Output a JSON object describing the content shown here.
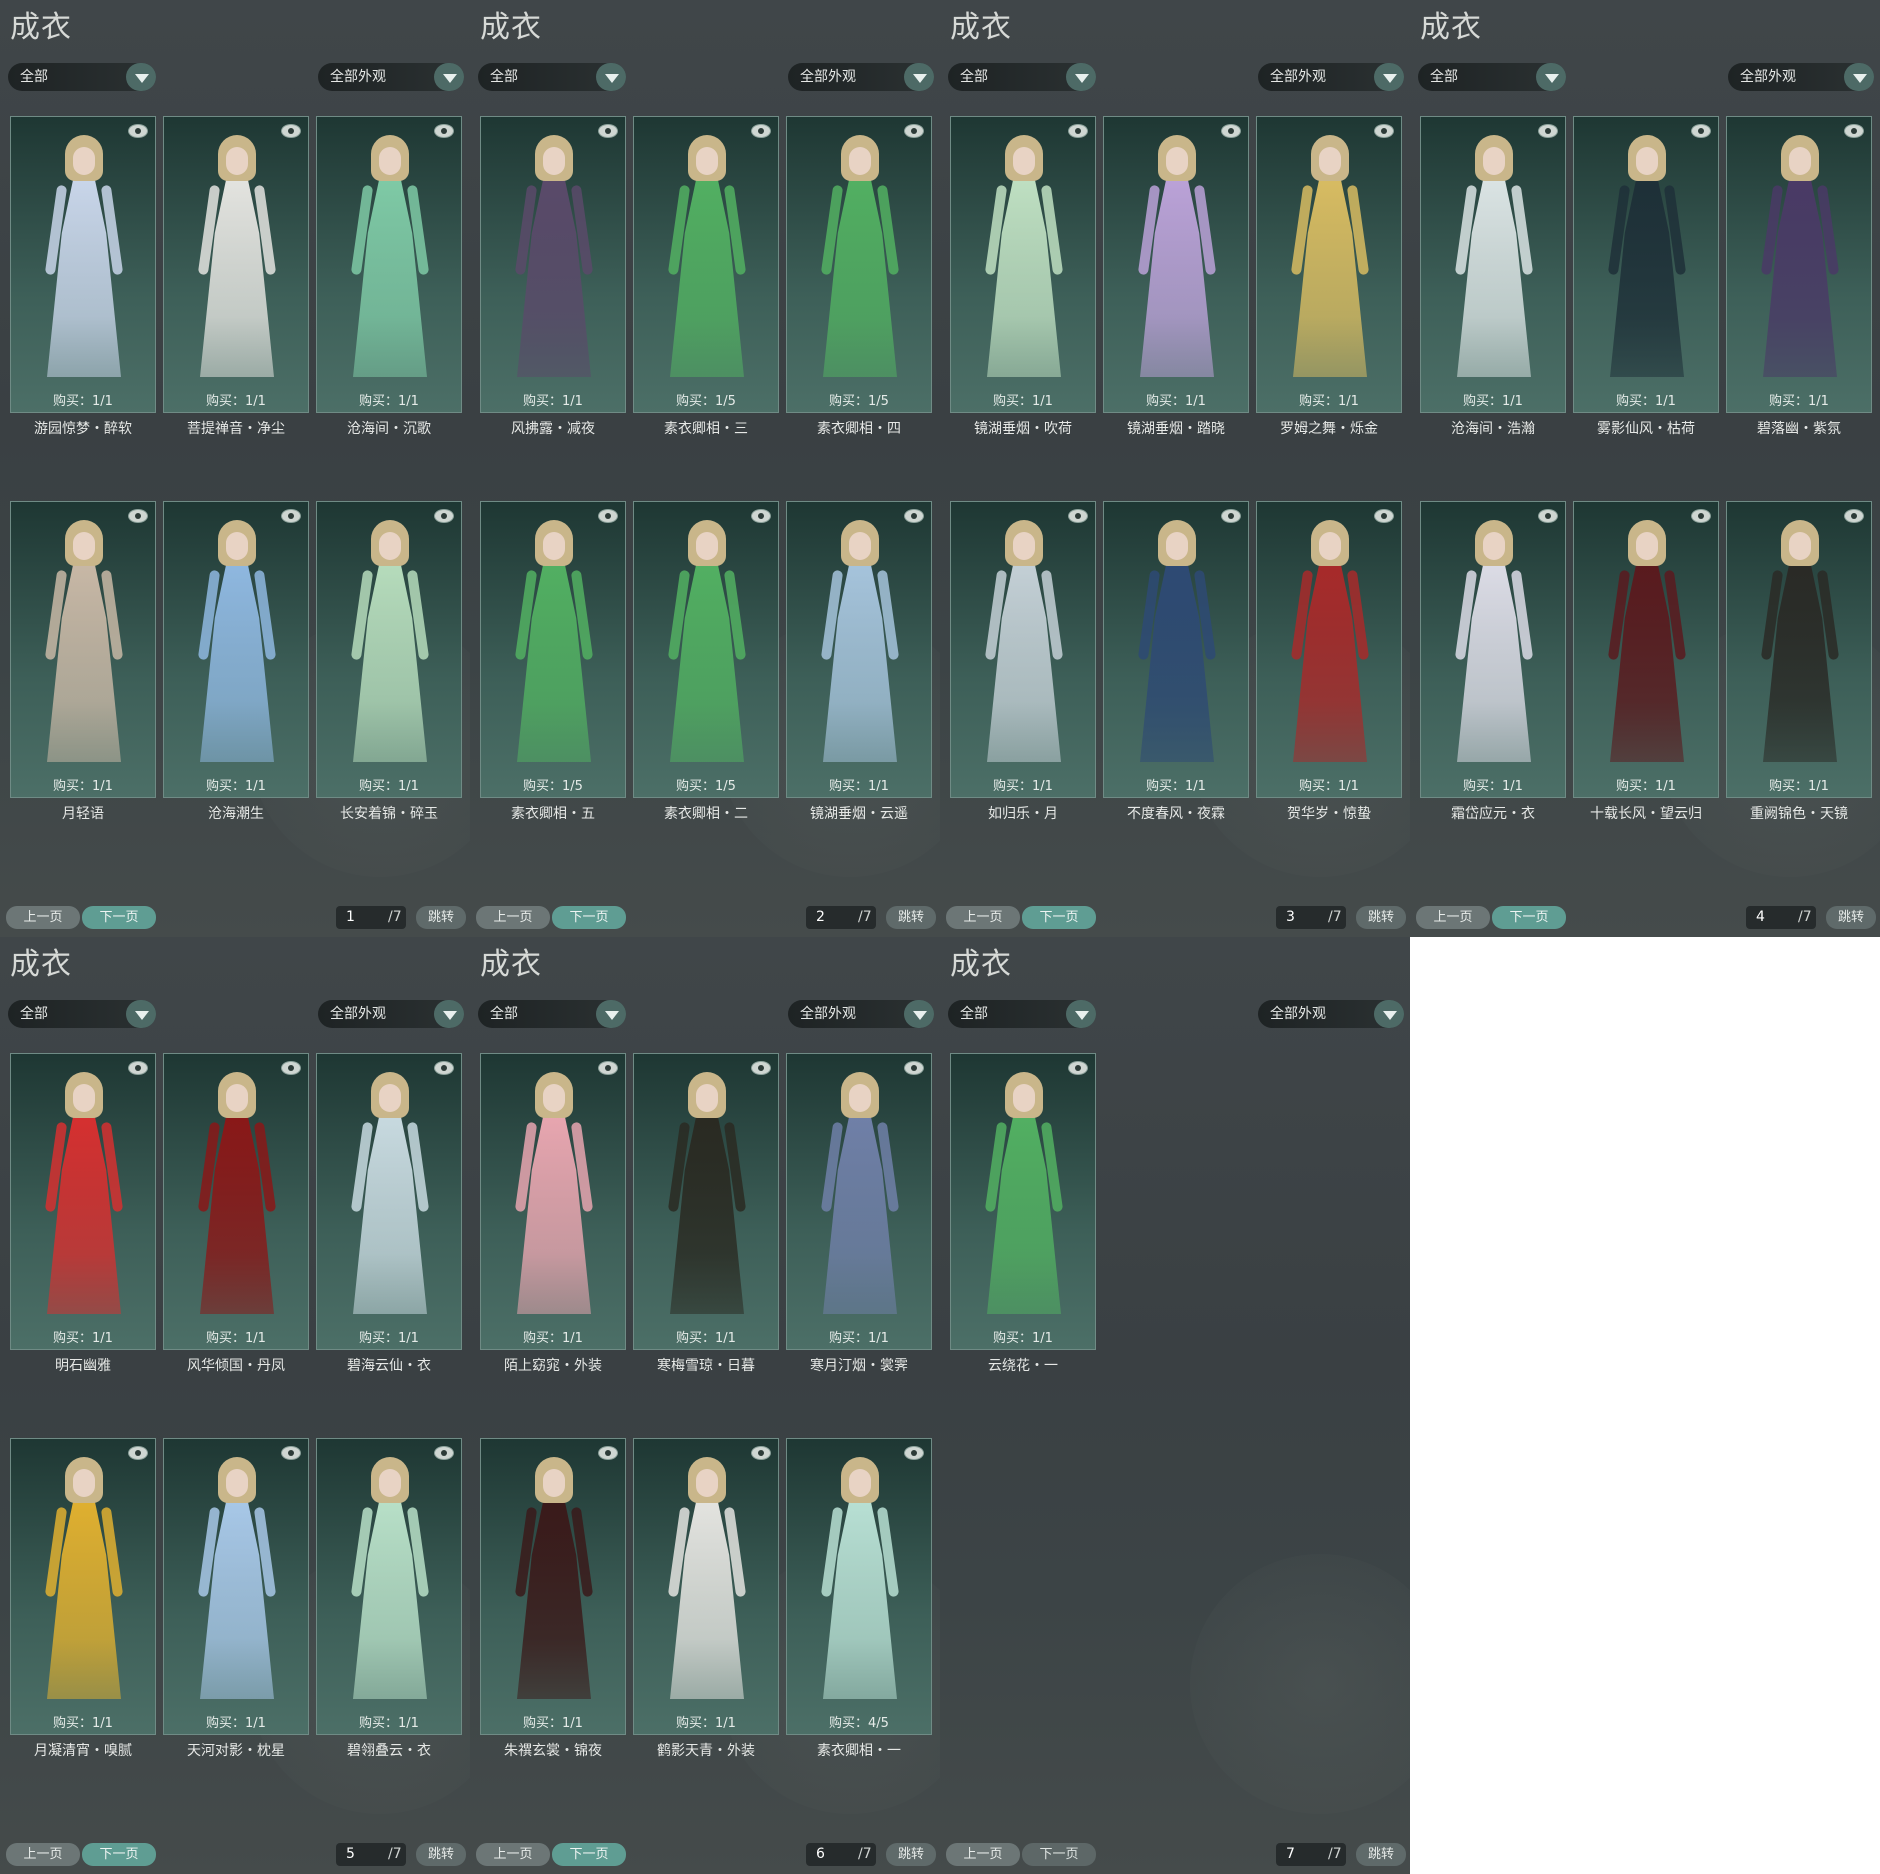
{
  "panel_title": "成衣",
  "filters": {
    "category": "全部",
    "appearance": "全部外观"
  },
  "buttons": {
    "prev": "上一页",
    "next": "下一页",
    "jump": "跳转"
  },
  "pages": [
    {
      "page": "1",
      "total": "/7",
      "items": [
        {
          "name": "游园惊梦・醉软",
          "buy": "购买：1/1",
          "color": "#c9d6ea"
        },
        {
          "name": "菩提禅音・净尘",
          "buy": "购买：1/1",
          "color": "#e4e4e0"
        },
        {
          "name": "沧海间・沉歌",
          "buy": "购买：1/1",
          "color": "#7fcaa6"
        },
        {
          "name": "风拂露・减夜",
          "buy": "购买：1/1",
          "color": "#5a4a6a"
        },
        {
          "name": "素衣卿相・三",
          "buy": "购买：1/5",
          "color": "#52b062"
        },
        {
          "name": "素衣卿相・四",
          "buy": "购买：1/5",
          "color": "#52b062"
        },
        {
          "name": "月轻语",
          "buy": "购买：1/1",
          "color": "#c8b8a6"
        },
        {
          "name": "沧海潮生",
          "buy": "购买：1/1",
          "color": "#8fb8e0"
        },
        {
          "name": "长安着锦・碎玉",
          "buy": "购买：1/1",
          "color": "#b6dcbc"
        },
        {
          "name": "",
          "buy": "",
          "color": ""
        },
        {
          "name": "",
          "buy": "",
          "color": ""
        },
        {
          "name": "",
          "buy": "",
          "color": ""
        }
      ]
    },
    {
      "page": "2",
      "total": "/7",
      "items": [
        {
          "name": "风拂露・减夜",
          "buy": "购买：1/1",
          "color": "#5a4a6a"
        },
        {
          "name": "素衣卿相・三",
          "buy": "购买：1/5",
          "color": "#52b062"
        },
        {
          "name": "素衣卿相・四",
          "buy": "购买：1/5",
          "color": "#52b062"
        },
        {
          "name": "素衣卿相・五",
          "buy": "购买：1/5",
          "color": "#52b062"
        },
        {
          "name": "素衣卿相・二",
          "buy": "购买：1/5",
          "color": "#52b062"
        },
        {
          "name": "镜湖垂烟・云遥",
          "buy": "购买：1/1",
          "color": "#a6c4dc"
        }
      ]
    },
    {
      "page": "3",
      "total": "/7",
      "items": [
        {
          "name": "镜湖垂烟・吹荷",
          "buy": "购买：1/1",
          "color": "#bfe0c2"
        },
        {
          "name": "镜湖垂烟・踏晓",
          "buy": "购买：1/1",
          "color": "#bba2d8"
        },
        {
          "name": "罗姆之舞・烁金",
          "buy": "购买：1/1",
          "color": "#d8bc62"
        },
        {
          "name": "如归乐・月",
          "buy": "购买：1/1",
          "color": "#c4d0d6"
        },
        {
          "name": "不度春风・夜霖",
          "buy": "购买：1/1",
          "color": "#2e4a74"
        },
        {
          "name": "贺华岁・惊蛰",
          "buy": "购买：1/1",
          "color": "#a82a2a"
        }
      ]
    },
    {
      "page": "4",
      "total": "/7",
      "items": [
        {
          "name": "沧海间・浩瀚",
          "buy": "购买：1/1",
          "color": "#dbe4e4"
        },
        {
          "name": "雾影仙风・枯荷",
          "buy": "购买：1/1",
          "color": "#1e3038"
        },
        {
          "name": "碧落幽・紫氛",
          "buy": "购买：1/1",
          "color": "#4a3a66"
        },
        {
          "name": "霜岱应元・衣",
          "buy": "购买：1/1",
          "color": "#dcdce6"
        },
        {
          "name": "十载长风・望云归",
          "buy": "购买：1/1",
          "color": "#5a1a1e"
        },
        {
          "name": "重阙锦色・天镜",
          "buy": "购买：1/1",
          "color": "#2a2a26"
        }
      ]
    },
    {
      "page": "5",
      "total": "/7",
      "items": [
        {
          "name": "明石幽雅",
          "buy": "购买：1/1",
          "color": "#d63030"
        },
        {
          "name": "风华倾国・丹凤",
          "buy": "购买：1/1",
          "color": "#8a1818"
        },
        {
          "name": "碧海云仙・衣",
          "buy": "购买：1/1",
          "color": "#c8dae0"
        },
        {
          "name": "月凝清宵・嗅腻",
          "buy": "购买：1/1",
          "color": "#e0b030"
        },
        {
          "name": "天河对影・枕星",
          "buy": "购买：1/1",
          "color": "#a8c8e8"
        },
        {
          "name": "碧翎叠云・衣",
          "buy": "购买：1/1",
          "color": "#b8e0c8"
        }
      ]
    },
    {
      "page": "6",
      "total": "/7",
      "items": [
        {
          "name": "陌上窈窕・外装",
          "buy": "购买：1/1",
          "color": "#e8a6b0"
        },
        {
          "name": "寒梅雪琼・日暮",
          "buy": "购买：1/1",
          "color": "#2a2a22"
        },
        {
          "name": "寒月汀烟・裳霁",
          "buy": "购买：1/1",
          "color": "#7080a8"
        },
        {
          "name": "朱禩玄裳・锦夜",
          "buy": "购买：1/1",
          "color": "#3a1a1a"
        },
        {
          "name": "鹤影天青・外装",
          "buy": "购买：1/1",
          "color": "#e4e4e0"
        },
        {
          "name": "素衣卿相・一",
          "buy": "购买：4/5",
          "color": "#b8e0d4"
        }
      ]
    },
    {
      "page": "7",
      "total": "/7",
      "items": [
        {
          "name": "云绕花・一",
          "buy": "购买：1/1",
          "color": "#52b062"
        }
      ]
    }
  ]
}
